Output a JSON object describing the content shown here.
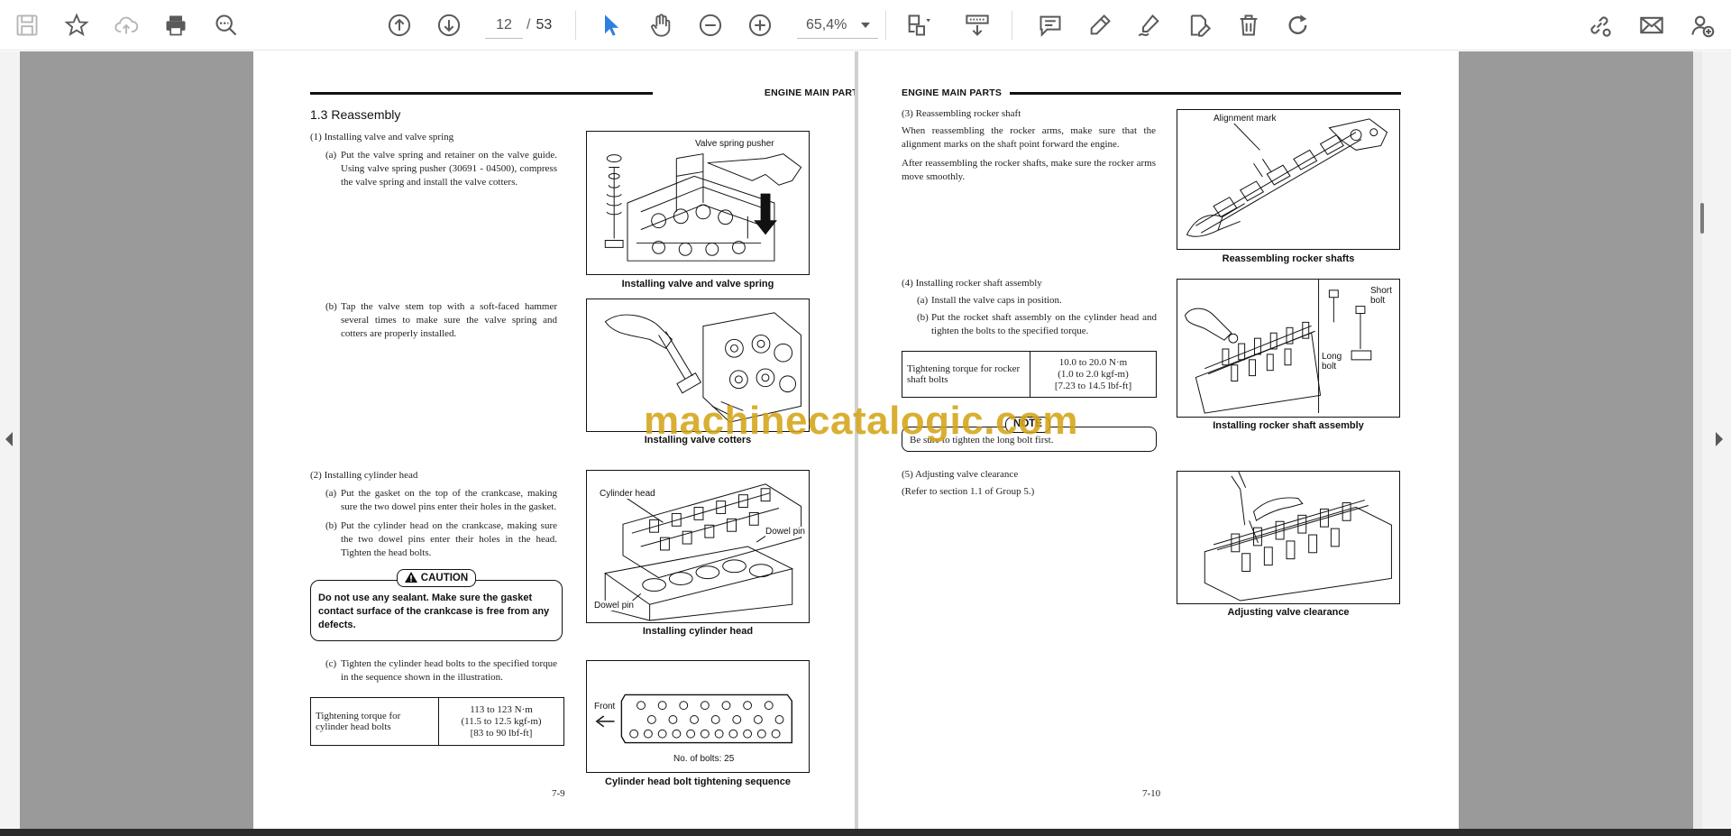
{
  "toolbar": {
    "page_current": "12",
    "page_separator": "/",
    "page_total": "53",
    "zoom": "65,4%"
  },
  "page1": {
    "header": "ENGINE MAIN PARTS",
    "section_title": "1.3   Reassembly",
    "step1_title": "(1)  Installing valve and valve spring",
    "step1a": "Put the valve spring and retainer on the valve guide. Using valve spring pusher (30691 - 04500), compress the valve spring and install the valve cotters.",
    "step1a_label": "(a)",
    "fig1_caption": "Installing valve and valve spring",
    "fig1_label": "Valve spring pusher",
    "step1b": "Tap the valve stem top with a soft-faced hammer several times to make sure the valve spring and cotters are properly installed.",
    "step1b_label": "(b)",
    "fig2_caption": "Installing valve cotters",
    "step2_title": "(2)  Installing cylinder head",
    "step2a_label": "(a)",
    "step2a": "Put the gasket on the top of the crankcase, making sure the two dowel pins enter their holes in the gasket.",
    "step2b_label": "(b)",
    "step2b": "Put the cylinder head on the crankcase, making sure the two dowel pins enter their holes in the head. Tighten the head bolts.",
    "caution_label": "CAUTION",
    "caution_text": "Do not use any sealant. Make sure the gasket contact surface of the crankcase is free from any defects.",
    "fig3_caption": "Installing cylinder head",
    "fig3_label_head": "Cylinder head",
    "fig3_label_dowel1": "Dowel pin",
    "fig3_label_dowel2": "Dowel pin",
    "step2c_label": "(c)",
    "step2c": "Tighten the cylinder head bolts to the specified torque in the sequence shown in the illustration.",
    "torque_label": "Tightening torque for cylinder head bolts",
    "torque_value_1": "113 to 123 N·m",
    "torque_value_2": "(11.5 to 12.5 kgf-m)",
    "torque_value_3": "[83 to 90 lbf-ft]",
    "fig4_caption": "Cylinder head bolt tightening sequence",
    "fig4_front": "Front",
    "fig4_bolts": "No. of bolts: 25",
    "page_number": "7-9"
  },
  "page2": {
    "header": "ENGINE MAIN PARTS",
    "step3_title": "(3)  Reassembling rocker shaft",
    "step3_p1": "When reassembling the rocker arms, make sure that the alignment marks on the shaft point forward the engine.",
    "step3_p2": "After reassembling the rocker shafts, make sure the rocker arms move smoothly.",
    "fig5_caption": "Reassembling rocker shafts",
    "fig5_label": "Alignment mark",
    "step4_title": "(4)  Installing rocker shaft assembly",
    "step4a_label": "(a)",
    "step4a": "Install the valve caps in position.",
    "step4b_label": "(b)",
    "step4b": "Put the rocket shaft assembly on the cylinder head and tighten the bolts to the specified torque.",
    "torque_label": "Tightening torque for rocker shaft bolts",
    "torque_value_1": "10.0 to 20.0 N·m",
    "torque_value_2": "(1.0 to 2.0 kgf-m)",
    "torque_value_3": "[7.23 to 14.5 lbf-ft]",
    "fig6_caption": "Installing rocker shaft assembly",
    "fig6_short": "Short bolt",
    "fig6_long": "Long bolt",
    "note_label": "NOTE",
    "note_text": "Be sure to tighten the long bolt first.",
    "step5_title": "(5)  Adjusting valve clearance",
    "step5_ref": "(Refer to section 1.1 of Group 5.)",
    "fig7_caption": "Adjusting valve clearance",
    "page_number": "7-10"
  },
  "watermark": "machinecatalogic.com",
  "colors": {
    "accent_blue": "#2f7fe0",
    "icon_gray": "#5a5a5a",
    "watermark": "#d4a418",
    "viewer_gray": "#9a9a9a"
  },
  "icons": [
    "save-icon",
    "bookmark-star-icon",
    "cloud-upload-icon",
    "print-icon",
    "zoom-out-magnifier-icon",
    "scroll-up-icon",
    "scroll-down-icon",
    "select-arrow-icon",
    "hand-icon",
    "zoom-out-icon",
    "zoom-in-icon",
    "crop-icon",
    "fit-icon",
    "comment-icon",
    "highlight-icon",
    "sign-icon",
    "edit-icon",
    "delete-icon",
    "redo-icon",
    "link-icon",
    "mail-icon",
    "user-add-icon"
  ]
}
